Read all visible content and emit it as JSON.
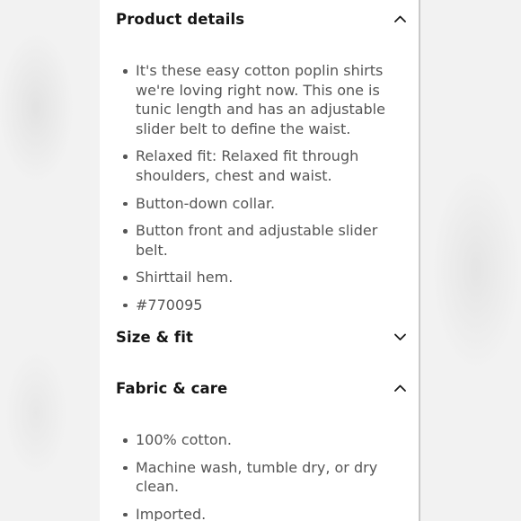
{
  "sections": {
    "product_details": {
      "title": "Product details",
      "expanded": true,
      "chevron_icon": "chevron-up-icon",
      "bullets": [
        "It's these easy cotton poplin shirts we're loving right now. This one is tunic length and has an adjustable slider belt to define the waist.",
        "Relaxed fit: Relaxed fit through shoulders, chest and waist.",
        "Button-down collar.",
        "Button front and adjustable slider belt.",
        "Shirttail hem.",
        "#770095"
      ]
    },
    "size_fit": {
      "title": "Size & fit",
      "expanded": false,
      "chevron_icon": "chevron-down-icon"
    },
    "fabric_care": {
      "title": "Fabric & care",
      "expanded": true,
      "chevron_icon": "chevron-up-icon",
      "bullets": [
        "100% cotton.",
        "Machine wash, tumble dry, or dry clean.",
        "Imported."
      ]
    }
  },
  "colors": {
    "heading_text": "#151515",
    "body_text": "#555555",
    "panel_bg": "#ffffff",
    "page_bg": "#f2f2f2"
  }
}
